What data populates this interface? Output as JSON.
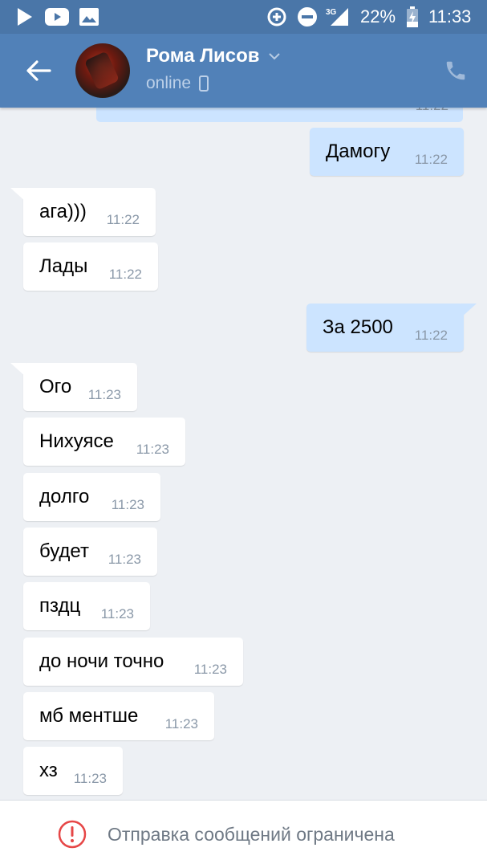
{
  "status_bar": {
    "battery": "22%",
    "time": "11:33",
    "network": "3G",
    "icons": [
      "play-store-icon",
      "youtube-icon",
      "gallery-icon",
      "data-saver-icon",
      "do-not-disturb-icon",
      "signal-icon",
      "battery-charging-icon"
    ]
  },
  "header": {
    "contact_name": "Рома Лисов",
    "presence": "online",
    "icons": [
      "back-arrow-icon",
      "chevron-down-icon",
      "mobile-phone-icon",
      "call-icon"
    ]
  },
  "messages": [
    {
      "direction": "out",
      "text": "",
      "time": "11:22",
      "partial": true
    },
    {
      "direction": "out",
      "text": "Дамогу",
      "time": "11:22"
    },
    {
      "direction": "in",
      "text": "ага)))",
      "time": "11:22"
    },
    {
      "direction": "in",
      "text": "Лады",
      "time": "11:22"
    },
    {
      "direction": "out",
      "text": "За 2500",
      "time": "11:22"
    },
    {
      "direction": "in",
      "text": "Ого",
      "time": "11:23"
    },
    {
      "direction": "in",
      "text": "Нихуясе",
      "time": "11:23"
    },
    {
      "direction": "in",
      "text": "долго",
      "time": "11:23"
    },
    {
      "direction": "in",
      "text": "будет",
      "time": "11:23"
    },
    {
      "direction": "in",
      "text": "пздц",
      "time": "11:23"
    },
    {
      "direction": "in",
      "text": "до ночи точно",
      "time": "11:23"
    },
    {
      "direction": "in",
      "text": "мб ментше",
      "time": "11:23"
    },
    {
      "direction": "in",
      "text": "хз",
      "time": "11:23"
    }
  ],
  "footer": {
    "notice": "Отправка сообщений ограничена",
    "icon": "error-circle-icon"
  },
  "colors": {
    "status_bar": "#4a76a8",
    "header": "#5181b8",
    "chat_bg": "#edf0f4",
    "incoming_bubble": "#ffffff",
    "outgoing_bubble": "#cce4ff",
    "warning_red": "#e64646"
  }
}
